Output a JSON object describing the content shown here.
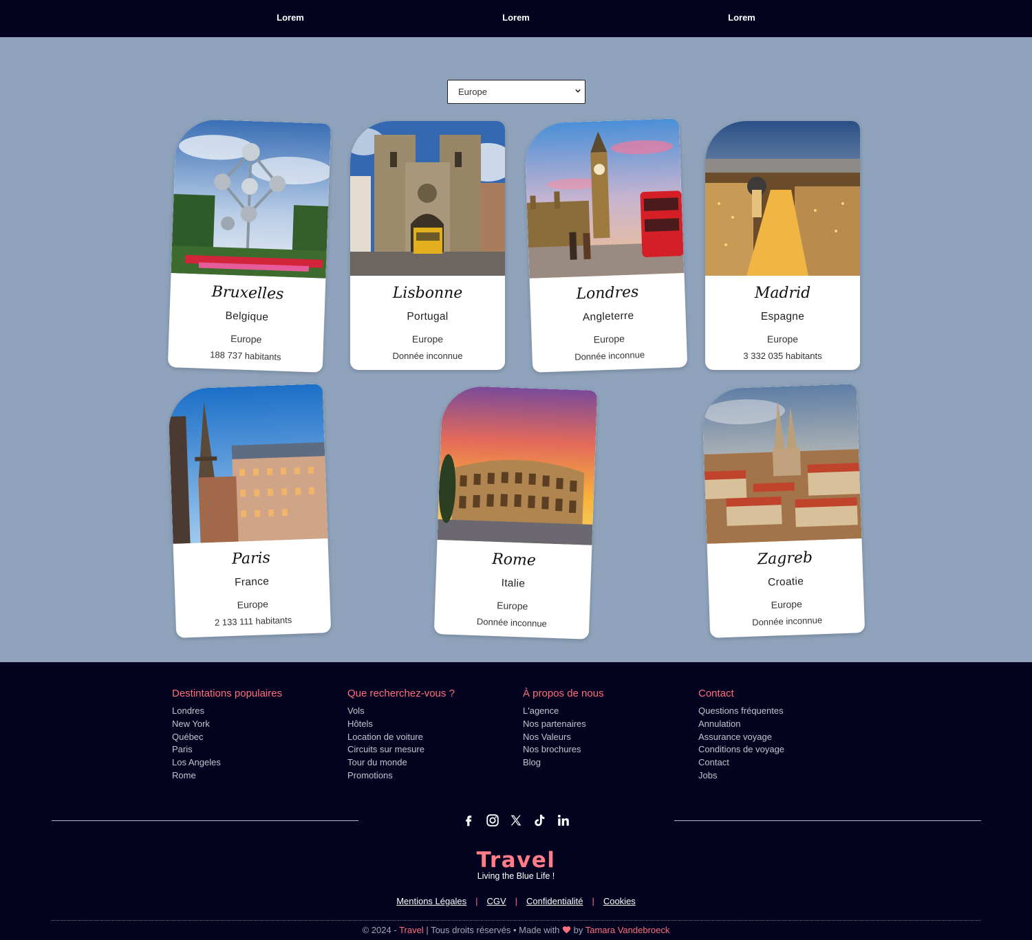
{
  "nav": {
    "links": [
      "Lorem",
      "Lorem",
      "Lorem"
    ]
  },
  "filter": {
    "selected": "Europe"
  },
  "cards": [
    {
      "city": "Bruxelles",
      "country": "Belgique",
      "region": "Europe",
      "population": "188 737 habitants"
    },
    {
      "city": "Lisbonne",
      "country": "Portugal",
      "region": "Europe",
      "population": "Donnée inconnue"
    },
    {
      "city": "Londres",
      "country": "Angleterre",
      "region": "Europe",
      "population": "Donnée inconnue"
    },
    {
      "city": "Madrid",
      "country": "Espagne",
      "region": "Europe",
      "population": "3 332 035 habitants"
    },
    {
      "city": "Paris",
      "country": "France",
      "region": "Europe",
      "population": "2 133 111 habitants"
    },
    {
      "city": "Rome",
      "country": "Italie",
      "region": "Europe",
      "population": "Donnée inconnue"
    },
    {
      "city": "Zagreb",
      "country": "Croatie",
      "region": "Europe",
      "population": "Donnée inconnue"
    }
  ],
  "footer": {
    "columns": [
      {
        "title": "Destintations populaires",
        "items": [
          "Londres",
          "New York",
          "Québec",
          "Paris",
          "Los Angeles",
          "Rome"
        ]
      },
      {
        "title": "Que recherchez-vous ?",
        "items": [
          "Vols",
          "Hôtels",
          "Location de voiture",
          "Circuits sur mesure",
          "Tour du monde",
          "Promotions"
        ]
      },
      {
        "title": "À propos de nous",
        "items": [
          "L'agence",
          "Nos partenaires",
          "Nos Valeurs",
          "Nos brochures",
          "Blog"
        ]
      },
      {
        "title": "Contact",
        "items": [
          "Questions fréquentes",
          "Annulation",
          "Assurance voyage",
          "Conditions de voyage",
          "Contact",
          "Jobs"
        ]
      }
    ],
    "social_icons": [
      "facebook-icon",
      "instagram-icon",
      "x-icon",
      "tiktok-icon",
      "linkedin-icon"
    ],
    "brand": "Travel",
    "tagline": "Living the Blue Life !",
    "legal_links": [
      "Mentions Légales",
      "CGV",
      "Confidentialité",
      "Cookies"
    ],
    "separator": "|",
    "copyright": {
      "prefix": "© 2024 - ",
      "brand": "Travel",
      "middle": " | Tous droits réservés • Made with ",
      "by": " by ",
      "author": "Tamara Vandebroeck"
    }
  },
  "colors": {
    "nav_bg": "#03031f",
    "page_bg": "#8ea2bb",
    "accent": "#ff6f7d",
    "brand": "#ff7c88"
  }
}
